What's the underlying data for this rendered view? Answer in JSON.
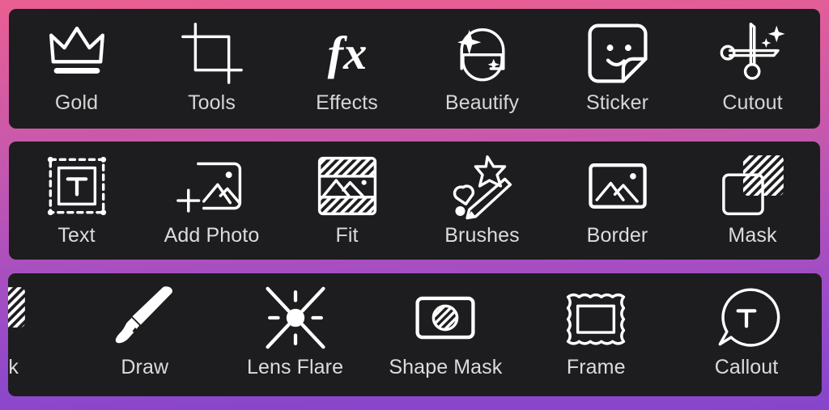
{
  "app": {
    "background_gradient_from": "#ea5f91",
    "background_gradient_to": "#8645cb",
    "panel_background": "#1d1d1f",
    "label_color": "#d6d6d6"
  },
  "rows": [
    {
      "name": "row-1",
      "items": [
        {
          "label": "Gold",
          "icon": "crown-icon"
        },
        {
          "label": "Tools",
          "icon": "crop-icon"
        },
        {
          "label": "Effects",
          "icon": "fx-icon"
        },
        {
          "label": "Beautify",
          "icon": "face-sparkle-icon"
        },
        {
          "label": "Sticker",
          "icon": "sticker-smiley-icon"
        },
        {
          "label": "Cutout",
          "icon": "scissors-sparkle-icon"
        }
      ]
    },
    {
      "name": "row-2",
      "items": [
        {
          "label": "Text",
          "icon": "text-box-icon"
        },
        {
          "label": "Add Photo",
          "icon": "add-photo-icon"
        },
        {
          "label": "Fit",
          "icon": "fit-icon"
        },
        {
          "label": "Brushes",
          "icon": "magic-pencil-icon"
        },
        {
          "label": "Border",
          "icon": "border-photo-icon"
        },
        {
          "label": "Mask",
          "icon": "mask-squares-icon"
        }
      ]
    },
    {
      "name": "row-3",
      "items": [
        {
          "label": "Mask",
          "icon": "mask-squares-icon"
        },
        {
          "label": "Draw",
          "icon": "paintbrush-icon"
        },
        {
          "label": "Lens Flare",
          "icon": "lens-flare-icon"
        },
        {
          "label": "Shape Mask",
          "icon": "shape-mask-icon"
        },
        {
          "label": "Frame",
          "icon": "frame-icon"
        },
        {
          "label": "Callout",
          "icon": "callout-bubble-icon"
        }
      ]
    }
  ]
}
